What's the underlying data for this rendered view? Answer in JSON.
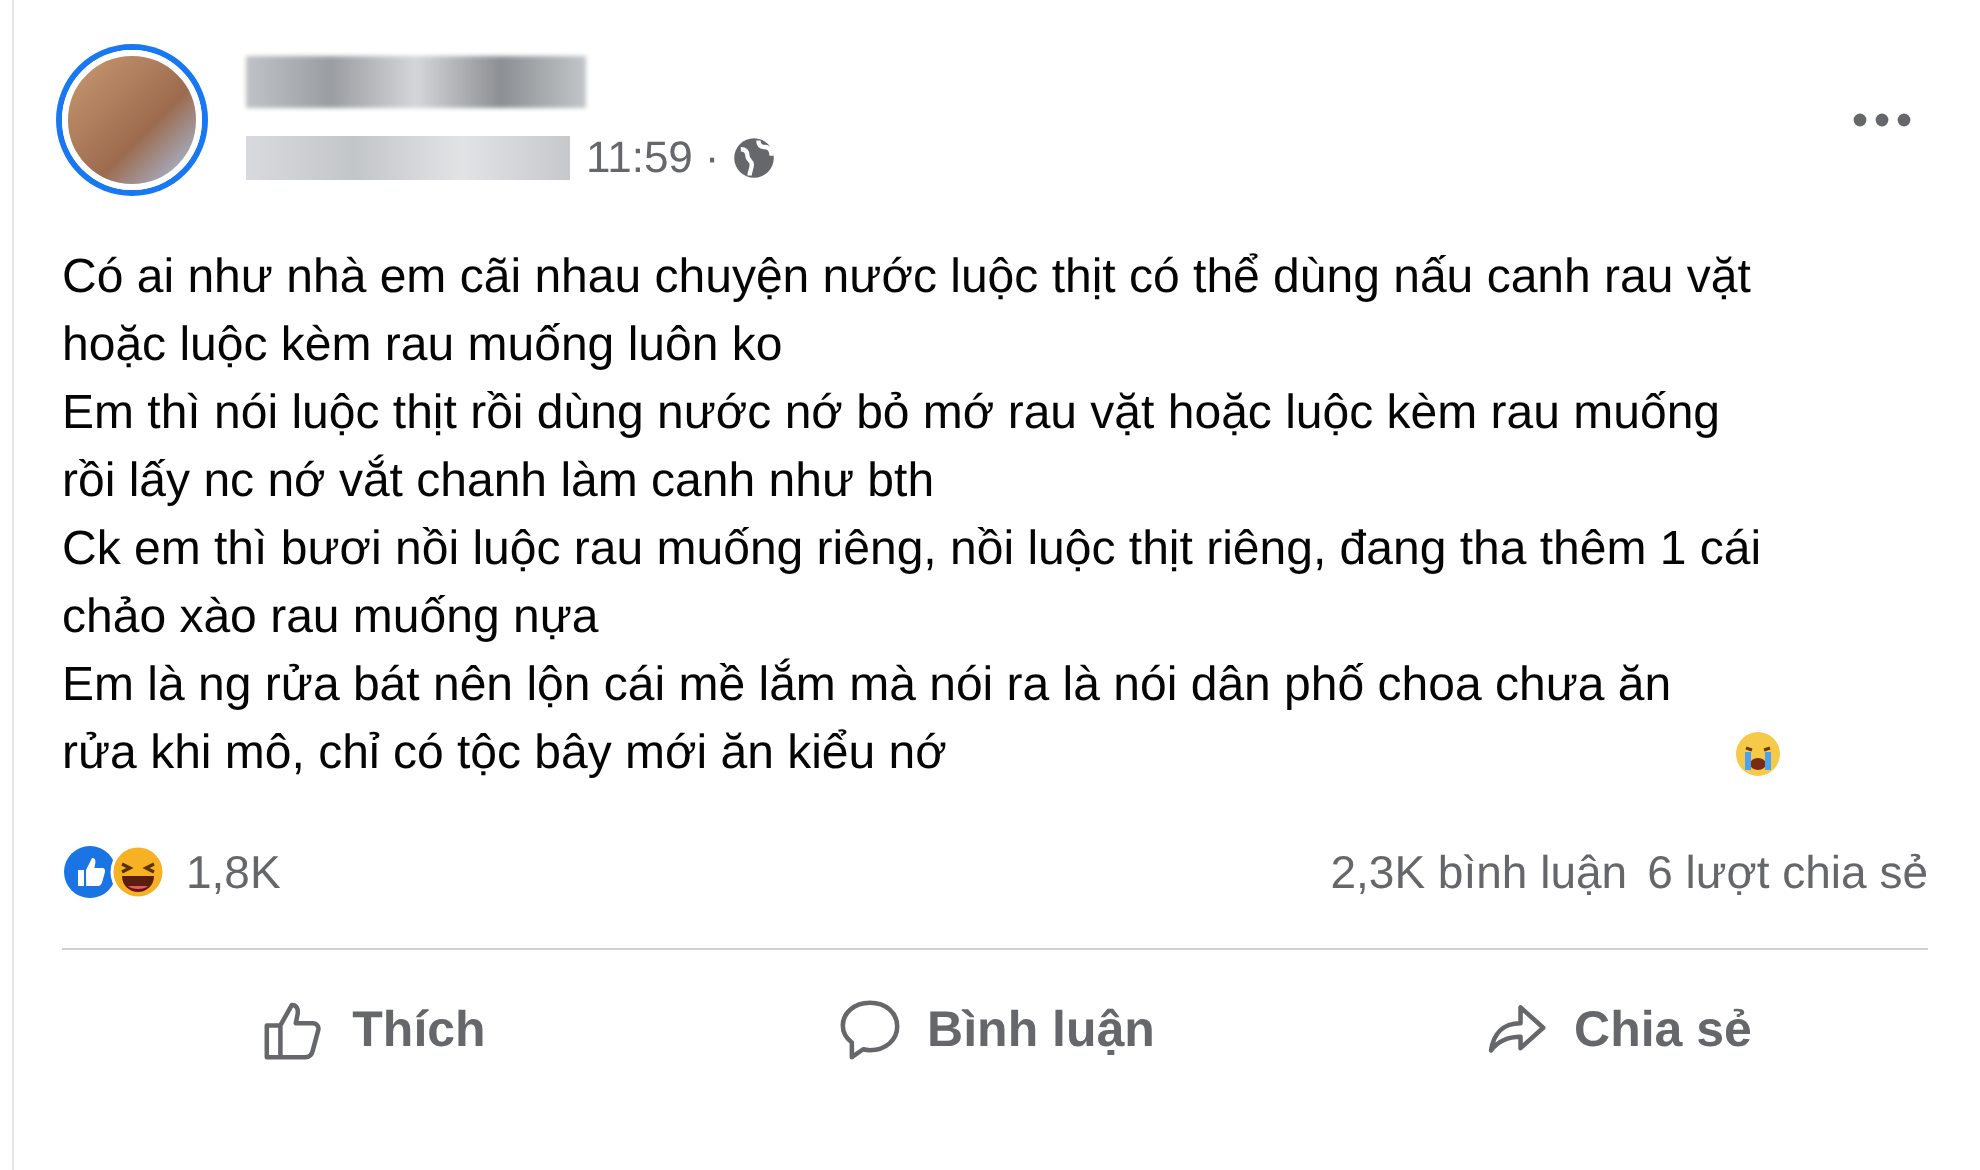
{
  "post": {
    "time": "11:59",
    "separator": "·",
    "paragraphs": [
      "Có ai như nhà em cãi nhau chuyện nước luộc thịt có thể dùng nấu canh rau vặt hoặc luộc kèm rau muống luôn ko",
      "Em thì nói luộc thịt rồi dùng nước nớ bỏ mớ rau vặt hoặc luộc kèm rau muống rồi lấy nc nớ vắt chanh làm canh như bth",
      "Ck em thì bươi nồi luộc rau muống riêng, nồi luộc thịt riêng, đang tha thêm 1 cái chảo xào rau muống nựa",
      "Em là ng rửa bát nên lộn cái mề lắm mà nói ra là nói dân phố choa chưa ăn rửa khi mô, chỉ có tộc bây mới ăn kiểu nớ"
    ],
    "reaction_count": "1,8K",
    "comments": "2,3K bình luận",
    "shares": "6 lượt chia sẻ",
    "actions": [
      {
        "kind": "like",
        "label": "Thích"
      },
      {
        "kind": "comment",
        "label": "Bình luận"
      },
      {
        "kind": "share",
        "label": "Chia sẻ"
      }
    ]
  }
}
